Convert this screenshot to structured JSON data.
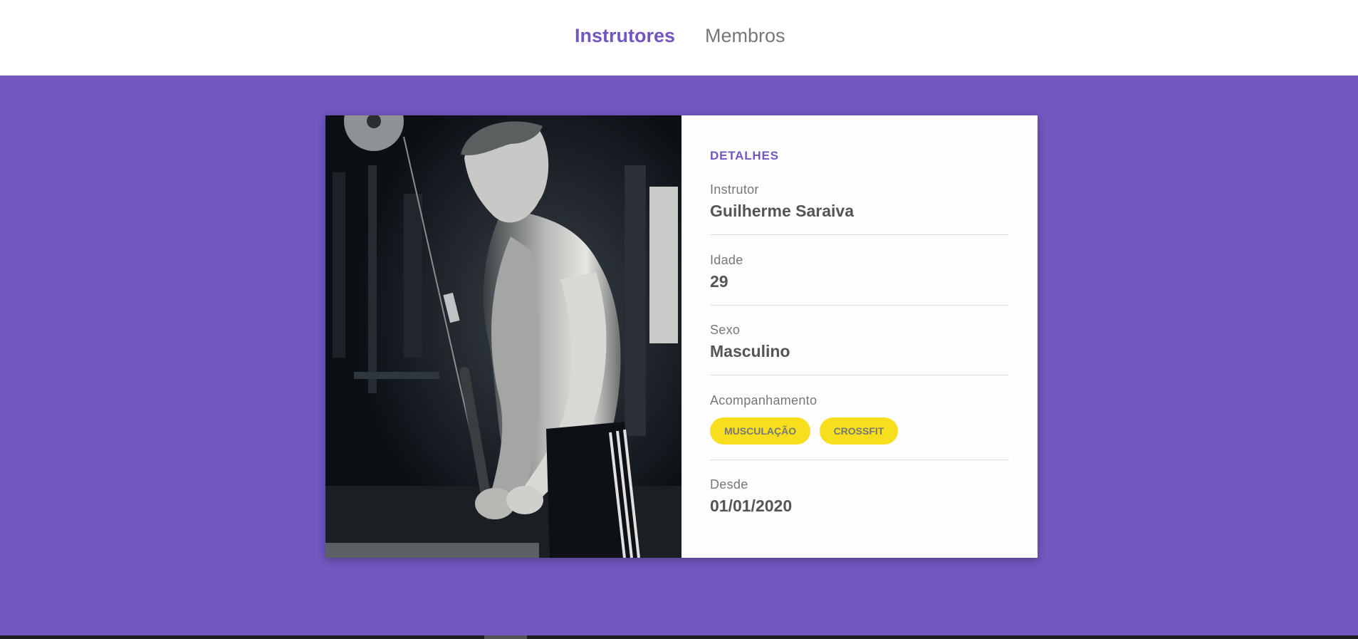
{
  "nav": {
    "items": [
      {
        "label": "Instrutores",
        "active": true
      },
      {
        "label": "Membros",
        "active": false
      }
    ]
  },
  "colors": {
    "accent": "#7157be",
    "chip": "#f7df1e",
    "text_label": "#777777",
    "text_value": "#555555"
  },
  "details": {
    "title": "DETALHES",
    "instructor": {
      "label": "Instrutor",
      "value": "Guilherme Saraiva"
    },
    "age": {
      "label": "Idade",
      "value": "29"
    },
    "sex": {
      "label": "Sexo",
      "value": "Masculino"
    },
    "tracking": {
      "label": "Acompanhamento",
      "tags": [
        "MUSCULAÇÃO",
        "CROSSFIT"
      ]
    },
    "since": {
      "label": "Desde",
      "value": "01/01/2020"
    }
  }
}
